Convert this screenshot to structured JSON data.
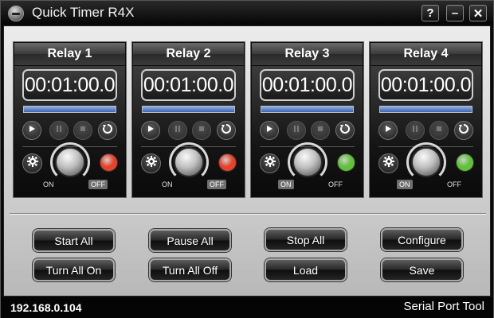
{
  "window": {
    "title": "Quick Timer R4X",
    "title_buttons": [
      "?",
      "–",
      "✕"
    ]
  },
  "relays": [
    {
      "name": "Relay 1",
      "time": "00:01:00.0",
      "progress": 1.0,
      "lamp_color": "#e8412a",
      "on_label": "ON",
      "off_label": "OFF",
      "state": "off"
    },
    {
      "name": "Relay 2",
      "time": "00:01:00.0",
      "progress": 1.0,
      "lamp_color": "#e8412a",
      "on_label": "ON",
      "off_label": "OFF",
      "state": "off"
    },
    {
      "name": "Relay 3",
      "time": "00:01:00.0",
      "progress": 1.0,
      "lamp_color": "#5fc237",
      "on_label": "ON",
      "off_label": "OFF",
      "state": "on"
    },
    {
      "name": "Relay 4",
      "time": "00:01:00.0",
      "progress": 1.0,
      "lamp_color": "#5fc237",
      "on_label": "ON",
      "off_label": "OFF",
      "state": "on"
    }
  ],
  "controls": {
    "icons": [
      "play-icon",
      "pause-icon",
      "stop-icon",
      "reset-icon",
      "gear-icon"
    ]
  },
  "actions": {
    "start_all": "Start All",
    "pause_all": "Pause All",
    "stop_all": "Stop All",
    "configure": "Configure",
    "turn_all_on": "Turn All On",
    "turn_all_off": "Turn All Off",
    "load": "Load",
    "save": "Save"
  },
  "status": {
    "ip": "192.168.0.104",
    "tool": "Serial Port Tool"
  },
  "colors": {
    "progress_fill": "#3b64b5",
    "lamp_red": "#e8412a",
    "lamp_green": "#5fc237"
  }
}
